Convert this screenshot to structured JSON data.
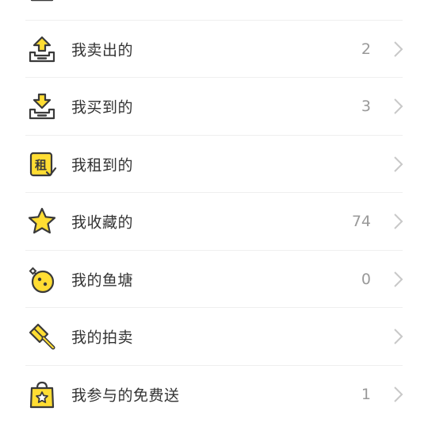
{
  "colors": {
    "accent": "#ffdd33",
    "icon_stroke": "#3a3a3a",
    "text": "#333333",
    "count": "#999999"
  },
  "menu": {
    "items": [
      {
        "id": "top-partial",
        "icon": "box-icon",
        "label": "",
        "count": ""
      },
      {
        "id": "sold",
        "icon": "tray-upload-icon",
        "label": "我卖出的",
        "count": "2"
      },
      {
        "id": "bought",
        "icon": "tray-download-icon",
        "label": "我买到的",
        "count": "3"
      },
      {
        "id": "rented",
        "icon": "rent-tag-icon",
        "label": "我租到的",
        "count": ""
      },
      {
        "id": "favorites",
        "icon": "star-icon",
        "label": "我收藏的",
        "count": "74"
      },
      {
        "id": "fishpond",
        "icon": "fishpond-icon",
        "label": "我的鱼塘",
        "count": "0"
      },
      {
        "id": "auction",
        "icon": "auction-hammer-icon",
        "label": "我的拍卖",
        "count": ""
      },
      {
        "id": "free-gifts",
        "icon": "gift-bag-icon",
        "label": "我参与的免费送",
        "count": "1"
      }
    ],
    "rent_icon_text": "租"
  }
}
